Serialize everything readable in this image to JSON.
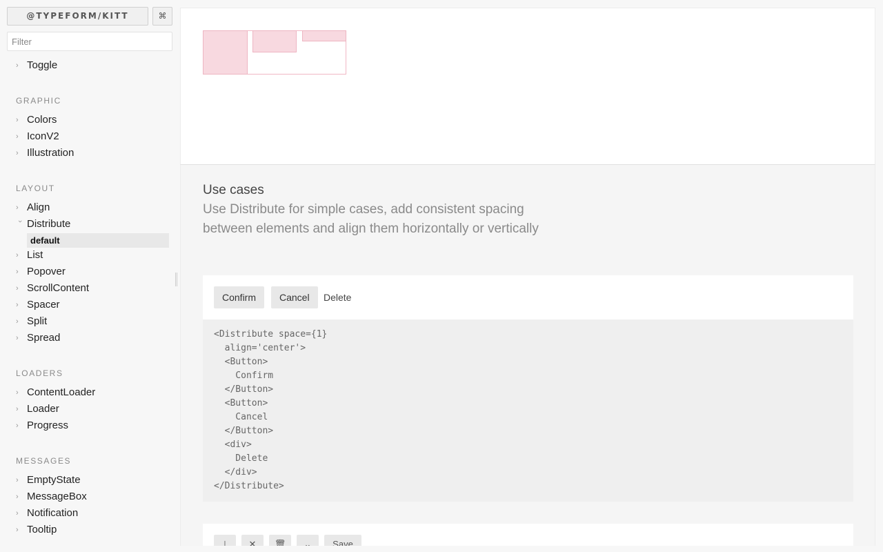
{
  "sidebar": {
    "brand": "@TYPEFORM/KITT",
    "shortcut_icon": "⌘",
    "filter_placeholder": "Filter",
    "toggle_item": "Toggle",
    "sections": {
      "graphic": {
        "title": "GRAPHIC",
        "items": [
          "Colors",
          "IconV2",
          "Illustration"
        ]
      },
      "layout": {
        "title": "LAYOUT",
        "items": [
          "Align",
          "Distribute",
          "List",
          "Popover",
          "ScrollContent",
          "Spacer",
          "Split",
          "Spread"
        ]
      },
      "loaders": {
        "title": "LOADERS",
        "items": [
          "ContentLoader",
          "Loader",
          "Progress"
        ]
      },
      "messages": {
        "title": "MESSAGES",
        "items": [
          "EmptyState",
          "MessageBox",
          "Notification",
          "Tooltip"
        ]
      }
    },
    "active_story": "default"
  },
  "docs": {
    "title": "Use cases",
    "description": "Use Distribute for simple cases, add consistent spacing between elements and align them horizontally or vertically",
    "example": {
      "buttons": [
        "Confirm",
        "Cancel"
      ],
      "plain_text": "Delete",
      "code_lines": [
        "<Distribute space={1}",
        "  align='center'>",
        "  <Button>",
        "    Confirm",
        "  </Button>",
        "  <Button>",
        "    Cancel",
        "  </Button>",
        "  <div>",
        "    Delete",
        "  </div>",
        "</Distribute>"
      ]
    },
    "example2": {
      "icons": [
        "⊥",
        "✕",
        "🗑",
        "⌄"
      ],
      "save_label": "Save"
    }
  },
  "colors": {
    "demo_fill": "#f8d9e0",
    "demo_border": "#eeb5c2"
  }
}
